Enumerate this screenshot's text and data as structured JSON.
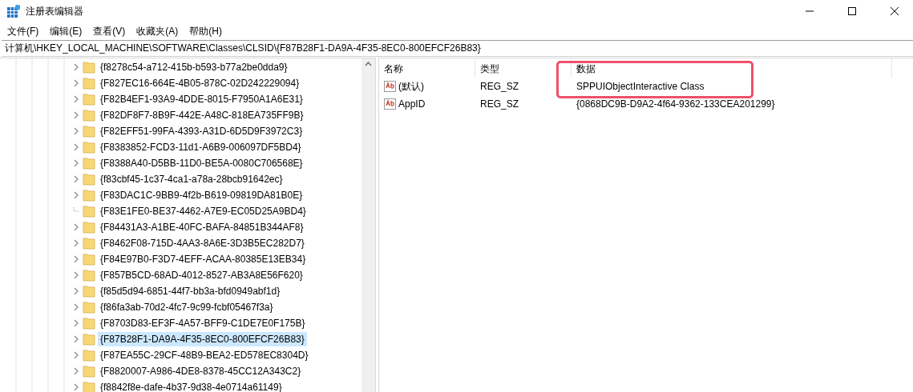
{
  "window": {
    "title": "注册表编辑器"
  },
  "menu": [
    "文件(F)",
    "编辑(E)",
    "查看(V)",
    "收藏夹(A)",
    "帮助(H)"
  ],
  "address": "计算机\\HKEY_LOCAL_MACHINE\\SOFTWARE\\Classes\\CLSID\\{F87B28F1-DA9A-4F35-8EC0-800EFCF26B83}",
  "tree": {
    "items": [
      {
        "label": "{f8278c54-a712-415b-b593-b77a2be0dda9}",
        "expandable": true,
        "selected": false
      },
      {
        "label": "{F827EC16-664E-4B05-878C-02D242229094}",
        "expandable": true,
        "selected": false
      },
      {
        "label": "{F82B4EF1-93A9-4DDE-8015-F7950A1A6E31}",
        "expandable": true,
        "selected": false
      },
      {
        "label": "{F82DF8F7-8B9F-442E-A48C-818EA735FF9B}",
        "expandable": true,
        "selected": false
      },
      {
        "label": "{F82EFF51-99FA-4393-A31D-6D5D9F3972C3}",
        "expandable": true,
        "selected": false
      },
      {
        "label": "{F8383852-FCD3-11d1-A6B9-006097DF5BD4}",
        "expandable": true,
        "selected": false
      },
      {
        "label": "{F8388A40-D5BB-11D0-BE5A-0080C706568E}",
        "expandable": true,
        "selected": false
      },
      {
        "label": "{f83cbf45-1c37-4ca1-a78a-28bcb91642ec}",
        "expandable": true,
        "selected": false
      },
      {
        "label": "{F83DAC1C-9BB9-4f2b-B619-09819DA81B0E}",
        "expandable": true,
        "selected": false
      },
      {
        "label": "{F83E1FE0-BE37-4462-A7E9-EC05D25A9BD4}",
        "expandable": false,
        "selected": false
      },
      {
        "label": "{F84431A3-A1BE-40FC-BAFA-84851B344AF8}",
        "expandable": true,
        "selected": false
      },
      {
        "label": "{F8462F08-715D-4AA3-8A6E-3D3B5EC282D7}",
        "expandable": true,
        "selected": false
      },
      {
        "label": "{F84E97B0-F3D7-4EFF-ACAA-80385E13EB34}",
        "expandable": true,
        "selected": false
      },
      {
        "label": "{F857B5CD-68AD-4012-8527-AB3A8E56F620}",
        "expandable": true,
        "selected": false
      },
      {
        "label": "{f85d5d94-6851-44f7-bb3a-bfd0949abf1d}",
        "expandable": true,
        "selected": false
      },
      {
        "label": "{f86fa3ab-70d2-4fc7-9c99-fcbf05467f3a}",
        "expandable": true,
        "selected": false
      },
      {
        "label": "{F8703D83-EF3F-4A57-BFF9-C1DE7E0F175B}",
        "expandable": true,
        "selected": false
      },
      {
        "label": "{F87B28F1-DA9A-4F35-8EC0-800EFCF26B83}",
        "expandable": true,
        "selected": true
      },
      {
        "label": "{F87EA55C-29CF-48B9-BEA2-ED578EC8304D}",
        "expandable": true,
        "selected": false
      },
      {
        "label": "{F8820007-A986-4DE8-8378-45CC12A343C2}",
        "expandable": true,
        "selected": false
      },
      {
        "label": "{f8842f8e-dafe-4b37-9d38-4e0714a61149}",
        "expandable": true,
        "selected": false
      }
    ]
  },
  "values": {
    "columns": [
      "名称",
      "类型",
      "数据"
    ],
    "rows": [
      {
        "name": "(默认)",
        "type": "REG_SZ",
        "data": "SPPUIObjectInteractive Class"
      },
      {
        "name": "AppID",
        "type": "REG_SZ",
        "data": "{0868DC9B-D9A2-4f64-9362-133CEA201299}"
      }
    ]
  }
}
